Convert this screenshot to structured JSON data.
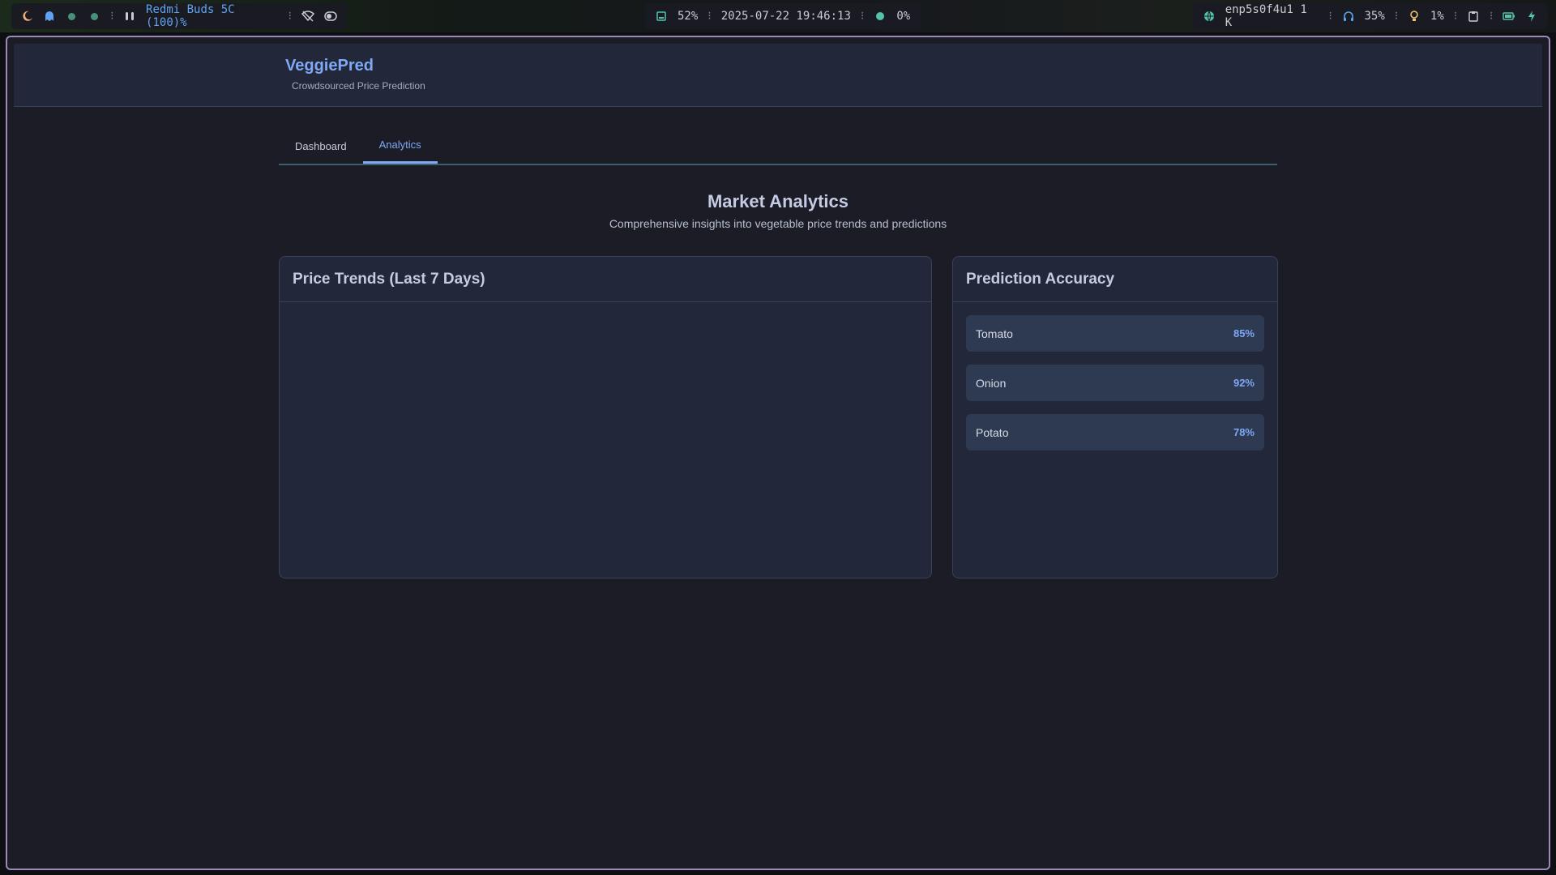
{
  "statusbar": {
    "bluetooth_device": "Redmi Buds 5C (100)%",
    "disk": "52%",
    "datetime": "2025-07-22 19:46:13",
    "cpu": "0%",
    "network": "enp5s0f4u1 1 K",
    "volume": "35%",
    "brightness": "1%",
    "separator": "⁝"
  },
  "app": {
    "brand": "VeggiePred",
    "tagline": "Crowdsourced Price Prediction"
  },
  "tabs": [
    {
      "label": "Dashboard",
      "active": false
    },
    {
      "label": "Analytics",
      "active": true
    }
  ],
  "page": {
    "title": "Market Analytics",
    "subtitle": "Comprehensive insights into vegetable price trends and predictions"
  },
  "price_trends": {
    "title": "Price Trends (Last 7 Days)"
  },
  "accuracy": {
    "title": "Prediction Accuracy",
    "items": [
      {
        "name": "Tomato",
        "value": "85%"
      },
      {
        "name": "Onion",
        "value": "92%"
      },
      {
        "name": "Potato",
        "value": "78%"
      }
    ]
  },
  "colors": {
    "accent": "#7fa8f5",
    "window_border": "#9b8ab3",
    "background": "#1b1c26",
    "card": "#222839"
  }
}
